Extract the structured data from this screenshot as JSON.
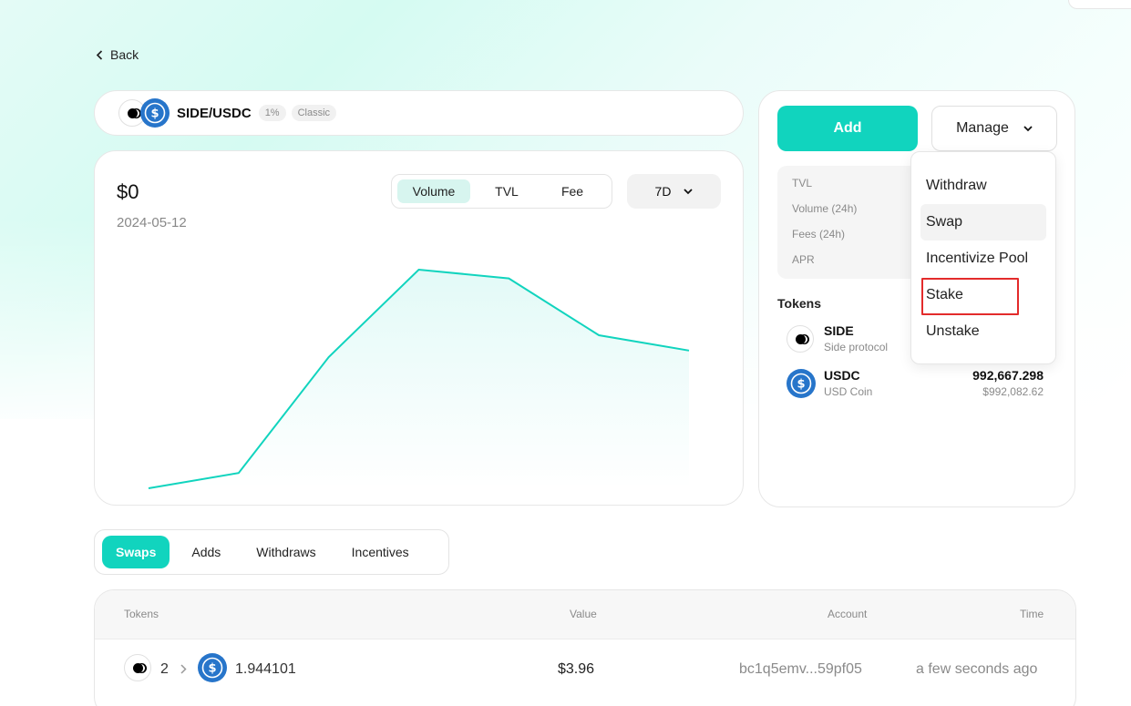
{
  "nav": {
    "back_label": "Back"
  },
  "pair": {
    "name": "SIDE/USDC",
    "fee_tier": "1%",
    "pool_type": "Classic",
    "token_a_icon": "side-protocol-logo",
    "token_b_icon": "usdc-logo"
  },
  "chart": {
    "value": "$0",
    "date": "2024-05-12",
    "metric_tabs": [
      "Volume",
      "TVL",
      "Fee"
    ],
    "active_metric": "Volume",
    "range_label": "7D",
    "line_color": "#11d4be"
  },
  "chart_data": {
    "type": "area",
    "x": [
      "d1",
      "d2",
      "d3",
      "d4",
      "d5",
      "d6",
      "d7"
    ],
    "values": [
      0.0,
      0.07,
      0.6,
      1.0,
      0.96,
      0.7,
      0.63
    ],
    "title": "",
    "xlabel": "",
    "ylabel": "",
    "ylim": [
      0,
      1
    ],
    "grid": false
  },
  "actions": {
    "add_label": "Add",
    "manage_label": "Manage"
  },
  "manage_menu": {
    "items": [
      "Withdraw",
      "Swap",
      "Incentivize Pool",
      "Stake",
      "Unstake"
    ],
    "hovered": "Swap",
    "highlighted": "Stake"
  },
  "stats": {
    "labels": [
      "TVL",
      "Volume (24h)",
      "Fees (24h)",
      "APR"
    ]
  },
  "tokens": {
    "title": "Tokens",
    "items": [
      {
        "symbol": "SIDE",
        "name": "Side protocol",
        "amount": "",
        "usd": ""
      },
      {
        "symbol": "USDC",
        "name": "USD Coin",
        "amount": "992,667.298",
        "usd": "$992,082.62"
      }
    ]
  },
  "activity_tabs": {
    "items": [
      "Swaps",
      "Adds",
      "Withdraws",
      "Incentives"
    ],
    "active": "Swaps"
  },
  "table": {
    "headers": [
      "Tokens",
      "Value",
      "Account",
      "Time"
    ],
    "rows": [
      {
        "from_amount": "2",
        "to_amount": "1.944101",
        "value": "$3.96",
        "account": "bc1q5emv...59pf05",
        "time": "a few seconds ago"
      }
    ]
  },
  "colors": {
    "accent": "#11d4be",
    "usdc_blue": "#2775ca",
    "highlight_red": "#e32b2b"
  }
}
